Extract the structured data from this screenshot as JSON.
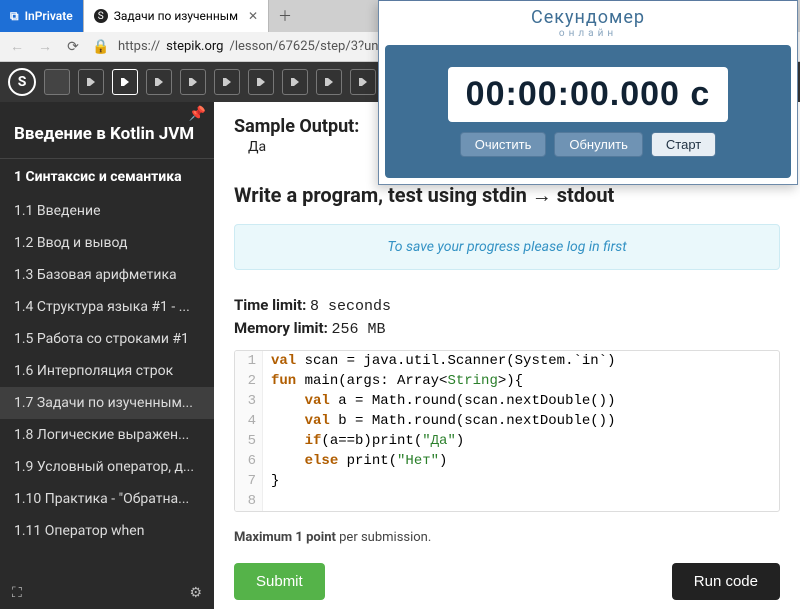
{
  "browser": {
    "tabs": [
      {
        "label": "InPrivate",
        "type": "private"
      },
      {
        "label": "Задачи по изученным",
        "type": "active"
      }
    ],
    "url_prefix": "https://",
    "url_host": "stepik.org",
    "url_path": "/lesson/67625/step/3?un"
  },
  "sidebar": {
    "course": "Введение в Kotlin JVM",
    "section": "1  Синтаксис и семантика",
    "items": [
      "1.1  Введение",
      "1.2  Ввод и вывод",
      "1.3  Базовая арифметика",
      "1.4  Структура языка #1 - ...",
      "1.5  Работа со строками #1",
      "1.6  Интерполяция строк",
      "1.7  Задачи по изученным...",
      "1.8  Логические выражен...",
      "1.9  Условный оператор, д...",
      "1.10  Практика - \"Обратна...",
      "1.11  Оператор when"
    ],
    "active_index": 6
  },
  "content": {
    "sample_output_label": "Sample Output:",
    "sample_output_value": "Да",
    "task_title": "Write a program, test using stdin → stdout",
    "banner": "To save your progress please log in first",
    "time_limit_label": "Time limit:",
    "time_limit_value": "8 seconds",
    "mem_limit_label": "Memory limit:",
    "mem_limit_value": "256 MB",
    "code_lines": [
      "val scan = java.util.Scanner(System.`in`)",
      "fun main(args: Array<String>){",
      "    val a = Math.round(scan.nextDouble())",
      "    val b = Math.round(scan.nextDouble())",
      "    if(a==b)print(\"Да\")",
      "    else print(\"Нет\")",
      "}",
      ""
    ],
    "max_points": "Maximum 1 point per submission.",
    "submit": "Submit",
    "run": "Run code"
  },
  "stopwatch": {
    "title": "Секундомер",
    "subtitle": "онлайн",
    "time": "00:00:00.000 с",
    "clear": "Очистить",
    "reset": "Обнулить",
    "start": "Старт"
  }
}
